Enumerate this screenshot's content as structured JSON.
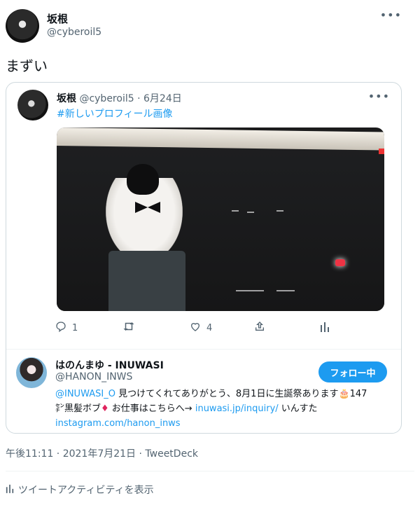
{
  "author": {
    "name": "坂根",
    "handle": "@cyberoil5"
  },
  "tweet": {
    "text": "まずい",
    "timestamp": "午後11:11 · 2021年7月21日 · TweetDeck",
    "activity_label": "ツイートアクティビティを表示"
  },
  "quoted": {
    "name": "坂根",
    "handle": "@cyberoil5",
    "separator": "·",
    "date": "6月24日",
    "hashtag": "#新しいプロフィール画像",
    "actions": {
      "reply_count": "1",
      "like_count": "4"
    }
  },
  "user_card": {
    "name": "はのんまゆ - INUWASI",
    "handle": "@HANON_INWS",
    "follow_label": "フォロー中",
    "bio_mention": "@INUWASI_O",
    "bio_line1": " 見つけてくれてありがとう、8月1日に生誕祭あります",
    "bio_cake": "🎂",
    "bio_line1_tail": "147",
    "bio_line2_start": "㌢黒髪ボブ",
    "bio_diamond": "♦",
    "bio_line2_mid": " お仕事はこちらへ→ ",
    "bio_link1": "inuwasi.jp/inquiry/",
    "bio_line2_end": " いんすた",
    "bio_link2": "instagram.com/hanon_inws"
  },
  "icons": {
    "more": "more-icon",
    "reply": "reply-icon",
    "retweet": "retweet-icon",
    "like": "heart-icon",
    "share": "share-icon",
    "analytics": "analytics-icon"
  },
  "colors": {
    "accent": "#1d9bf0",
    "text": "#0f1419",
    "muted": "#536471",
    "border": "#cfd9de"
  }
}
